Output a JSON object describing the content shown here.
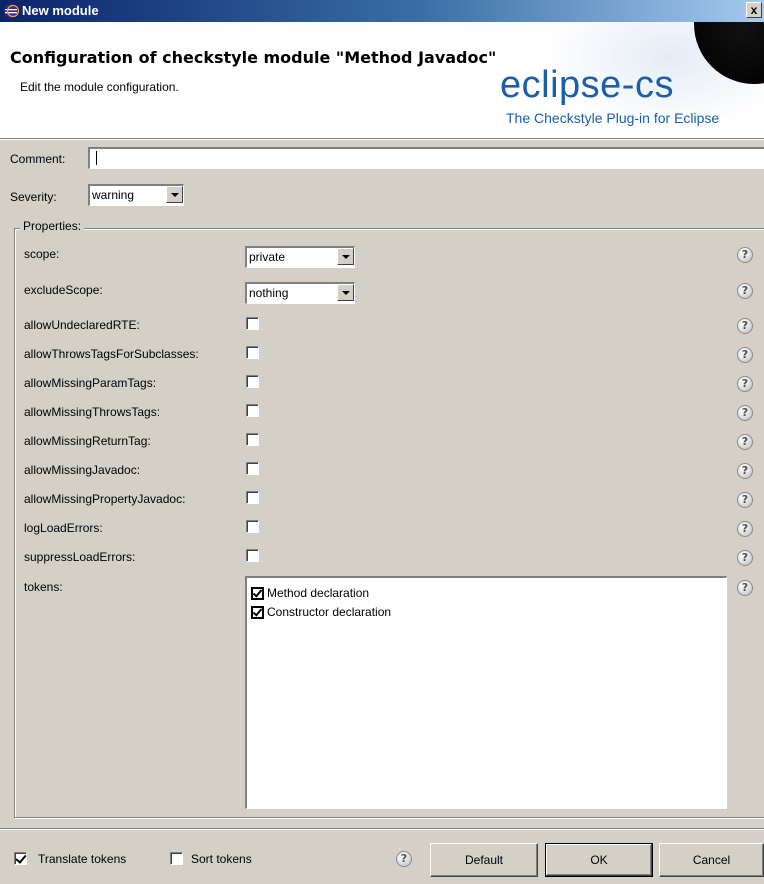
{
  "window": {
    "title": "New module",
    "close_glyph": "x"
  },
  "header": {
    "heading": "Configuration of checkstyle module \"Method Javadoc\"",
    "subtitle": "Edit the module configuration.",
    "logo_text": "eclipse-cs",
    "tagline": "The Checkstyle Plug-in for Eclipse",
    "logo_color": "#1a5fa8"
  },
  "form": {
    "comment_label": "Comment:",
    "comment_value": "",
    "severity_label": "Severity:",
    "severity_value": "warning"
  },
  "properties": {
    "group_label": "Properties:",
    "rows": [
      {
        "label": "scope:",
        "type": "combo",
        "value": "private"
      },
      {
        "label": "excludeScope:",
        "type": "combo",
        "value": "nothing"
      },
      {
        "label": "allowUndeclaredRTE:",
        "type": "checkbox",
        "checked": false
      },
      {
        "label": "allowThrowsTagsForSubclasses:",
        "type": "checkbox",
        "checked": false
      },
      {
        "label": "allowMissingParamTags:",
        "type": "checkbox",
        "checked": false
      },
      {
        "label": "allowMissingThrowsTags:",
        "type": "checkbox",
        "checked": false
      },
      {
        "label": "allowMissingReturnTag:",
        "type": "checkbox",
        "checked": false
      },
      {
        "label": "allowMissingJavadoc:",
        "type": "checkbox",
        "checked": false
      },
      {
        "label": "allowMissingPropertyJavadoc:",
        "type": "checkbox",
        "checked": false
      },
      {
        "label": "logLoadErrors:",
        "type": "checkbox",
        "checked": false
      },
      {
        "label": "suppressLoadErrors:",
        "type": "checkbox",
        "checked": false
      },
      {
        "label": "tokens:",
        "type": "list"
      }
    ],
    "tokens": [
      {
        "label": "Method declaration",
        "checked": true
      },
      {
        "label": "Constructor declaration",
        "checked": true
      }
    ],
    "help_glyph": "?"
  },
  "footer": {
    "translate_tokens_label": "Translate tokens",
    "translate_tokens_checked": true,
    "sort_tokens_label": "Sort tokens",
    "sort_tokens_checked": false,
    "default_label": "Default",
    "ok_label": "OK",
    "cancel_label": "Cancel"
  }
}
